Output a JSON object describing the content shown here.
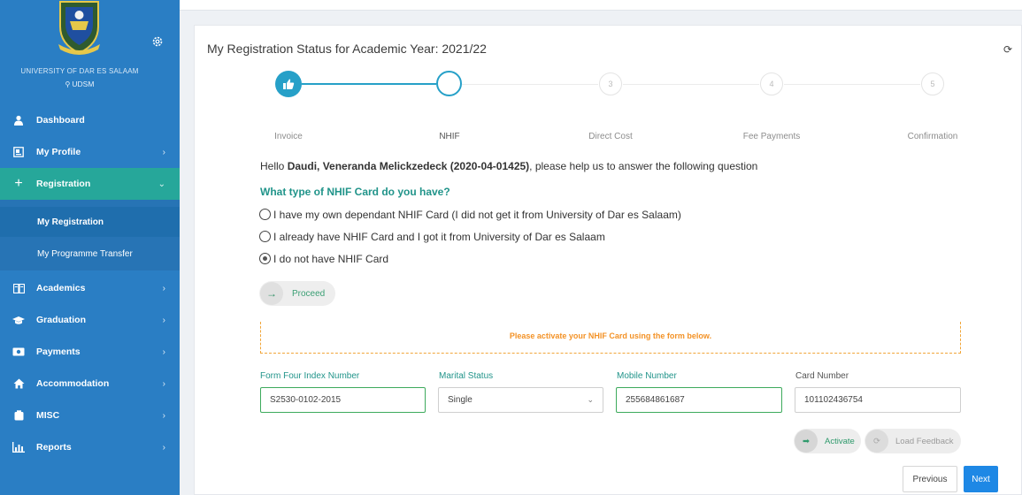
{
  "sidebar": {
    "university": "UNIVERSITY OF DAR ES SALAAM",
    "location": "UDSM",
    "items": [
      {
        "label": "Dashboard",
        "icon": "user-icon",
        "chevron": ""
      },
      {
        "label": "My Profile",
        "icon": "profile-card-icon",
        "chevron": "›"
      },
      {
        "label": "Registration",
        "icon": "plus-icon",
        "chevron": "⌄"
      },
      {
        "label": "Academics",
        "icon": "book-icon",
        "chevron": "›"
      },
      {
        "label": "Graduation",
        "icon": "graduation-cap-icon",
        "chevron": "›"
      },
      {
        "label": "Payments",
        "icon": "money-icon",
        "chevron": "›"
      },
      {
        "label": "Accommodation",
        "icon": "home-icon",
        "chevron": "›"
      },
      {
        "label": "MISC",
        "icon": "archive-icon",
        "chevron": "›"
      },
      {
        "label": "Reports",
        "icon": "chart-icon",
        "chevron": "›"
      }
    ],
    "subitems": [
      "My Registration",
      "My Programme Transfer"
    ]
  },
  "card": {
    "title": "My Registration Status for Academic Year: 2021/22"
  },
  "stepper": {
    "steps": [
      {
        "label": "Invoice",
        "number": ""
      },
      {
        "label": "NHIF",
        "number": ""
      },
      {
        "label": "Direct Cost",
        "number": "3"
      },
      {
        "label": "Fee Payments",
        "number": "4"
      },
      {
        "label": "Confirmation",
        "number": "5"
      }
    ]
  },
  "greeting": {
    "prefix": "Hello ",
    "name": "Daudi, Veneranda Melickzedeck (2020-04-01425)",
    "suffix": ", please help us to answer the following question"
  },
  "question": "What type of NHIF Card do you have?",
  "options": [
    "I have my own dependant NHIF Card (I did not get it from University of Dar es Salaam)",
    "I already have NHIF Card and I got it from University of Dar es Salaam",
    "I do not have NHIF Card"
  ],
  "selected_option": 2,
  "proceed_label": "Proceed",
  "notice": "Please activate your NHIF Card using the form below.",
  "form": {
    "index_label": "Form Four Index Number",
    "index_value": "S2530-0102-2015",
    "marital_label": "Marital Status",
    "marital_value": "Single",
    "mobile_label": "Mobile Number",
    "mobile_value": "255684861687",
    "card_label": "Card Number",
    "card_value": "101102436754"
  },
  "buttons": {
    "activate": "Activate",
    "load_feedback": "Load Feedback",
    "previous": "Previous",
    "next": "Next"
  },
  "colors": {
    "sidebar": "#2a7ec4",
    "active_nav": "#26a79a",
    "accent_teal": "#21948a",
    "notice_orange": "#f39226",
    "next_blue": "#1e88e5"
  }
}
